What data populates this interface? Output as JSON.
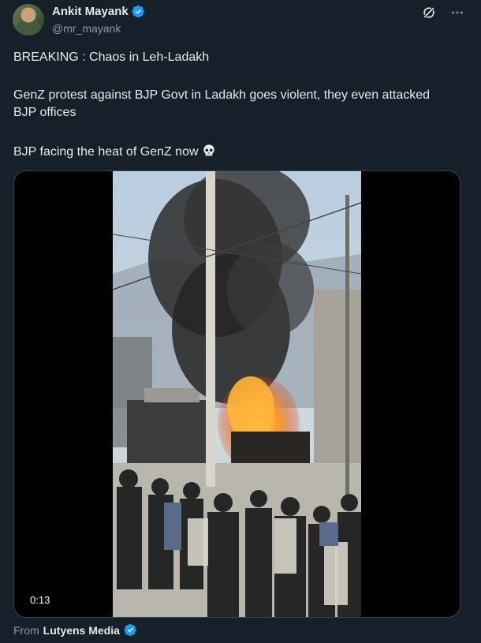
{
  "author": {
    "display_name": "Ankit Mayank",
    "handle": "@mr_mayank"
  },
  "tweet": {
    "line1": "BREAKING : Chaos in Leh-Ladakh",
    "line2": "GenZ protest against BJP Govt in Ladakh goes violent, they even attacked BJP offices",
    "line3": "BJP facing the heat of GenZ now"
  },
  "media": {
    "duration": "0:13"
  },
  "source": {
    "from_label": "From",
    "name": "Lutyens Media"
  },
  "icons": {
    "verified": "verified-badge-icon",
    "grok": "grok-icon",
    "more": "more-icon",
    "skull": "skull-icon"
  },
  "colors": {
    "background": "#15202b",
    "verified": "#1d9bf0",
    "muted": "#8b98a5"
  }
}
